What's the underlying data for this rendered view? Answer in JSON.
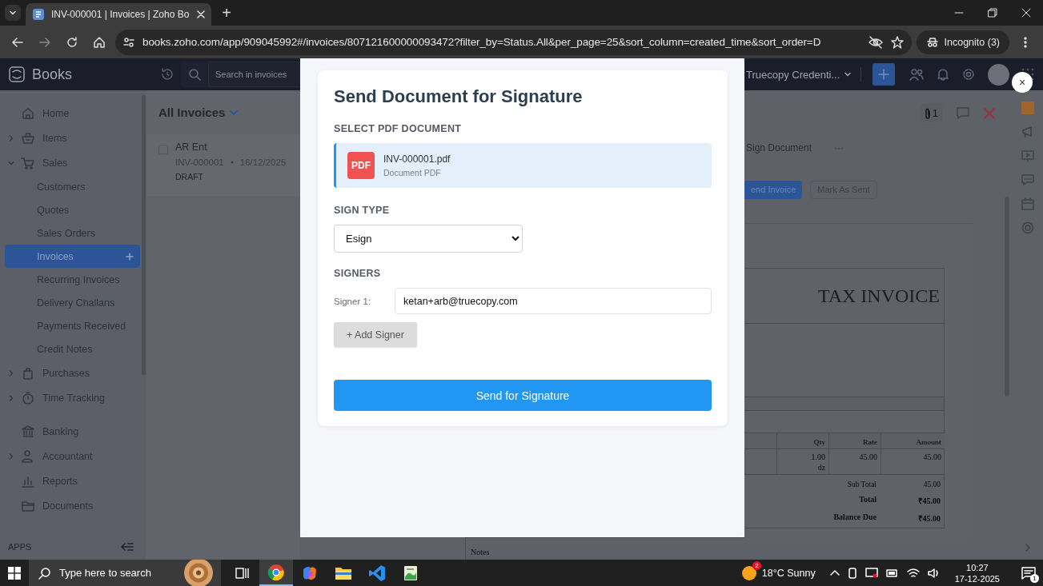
{
  "browser": {
    "tabs": [
      {
        "title": "INV-000001 | Invoices | Zoho Bo",
        "selected": true
      }
    ],
    "new_tab": "+",
    "url": "books.zoho.com/app/909045992#/invoices/807121600000093472?filter_by=Status.All&per_page=25&sort_column=created_time&sort_order=D",
    "profile": "Incognito (3)"
  },
  "app": {
    "logo": "Books",
    "search": {
      "placeholder": "Search in invoices"
    },
    "org": "Truecopy Credenti...",
    "sidebar": {
      "sections": [
        [
          {
            "label": "Home",
            "kind": "link"
          },
          {
            "label": "Items",
            "kind": "group",
            "expanded": false
          },
          {
            "label": "Sales",
            "kind": "group",
            "expanded": true,
            "children": [
              {
                "label": "Customers",
                "selected": false
              },
              {
                "label": "Quotes",
                "selected": false
              },
              {
                "label": "Sales Orders",
                "selected": false
              },
              {
                "label": "Invoices",
                "selected": true
              },
              {
                "label": "Recurring Invoices",
                "selected": false
              },
              {
                "label": "Delivery Challans",
                "selected": false
              },
              {
                "label": "Payments Received",
                "selected": false
              },
              {
                "label": "Credit Notes",
                "selected": false
              }
            ]
          },
          {
            "label": "Purchases",
            "kind": "group",
            "expanded": false
          },
          {
            "label": "Time Tracking",
            "kind": "group",
            "expanded": false
          }
        ],
        [
          {
            "label": "Banking",
            "kind": "link"
          },
          {
            "label": "Accountant",
            "kind": "group",
            "expanded": false
          },
          {
            "label": "Reports",
            "kind": "link"
          },
          {
            "label": "Documents",
            "kind": "link"
          }
        ]
      ],
      "footer": "APPS"
    },
    "list": {
      "title": "All Invoices",
      "rows": [
        {
          "name": "AR Ent",
          "number": "INV-000001",
          "date": "16/12/2025",
          "status": "DRAFT",
          "checked": false
        }
      ]
    },
    "detail": {
      "attachments": "1",
      "actions": [
        "Sign Document"
      ],
      "more": "···",
      "buttons": [
        {
          "label": "end Invoice",
          "kind": "primary"
        },
        {
          "label": "Mark As Sent",
          "kind": "secondary"
        }
      ],
      "invoice": {
        "title": "TAX INVOICE",
        "columns": [
          "Qty",
          "Rate",
          "Amount"
        ],
        "rows": [
          {
            "qty": "1.00",
            "unit": "dz",
            "rate": "45.00",
            "amount": "45.00"
          }
        ],
        "totals": [
          {
            "label": "Sub Total",
            "value": "45.00",
            "bold": false
          },
          {
            "label": "Total",
            "value": "₹45.00",
            "bold": true
          },
          {
            "label": "Balance Due",
            "value": "₹45.00",
            "bold": true
          }
        ],
        "notes_label": "Notes"
      }
    }
  },
  "dialog": {
    "title": "Send Document for Signature",
    "file_section": "SELECT PDF DOCUMENT",
    "file": {
      "badge": "PDF",
      "name": "INV-000001.pdf",
      "type": "Document PDF",
      "selected": true
    },
    "sign_type_label": "SIGN TYPE",
    "sign_type": "Esign",
    "signers_label": "SIGNERS",
    "signers": [
      {
        "label": "Signer 1:",
        "value": "ketan+arb@truecopy.com"
      }
    ],
    "add_button": "+ Add Signer",
    "submit_button": "Send for Signature"
  },
  "close_button": "×",
  "taskbar": {
    "search_placeholder": "Type here to search",
    "apps": [
      {
        "selected": false
      },
      {
        "selected": true
      },
      {
        "selected": false
      },
      {
        "selected": false
      },
      {
        "selected": false
      },
      {
        "selected": false
      }
    ],
    "weather": {
      "badge": "2",
      "text": "18°C  Sunny"
    },
    "time": "10:27",
    "date": "17-12-2025",
    "notifications": "1"
  }
}
